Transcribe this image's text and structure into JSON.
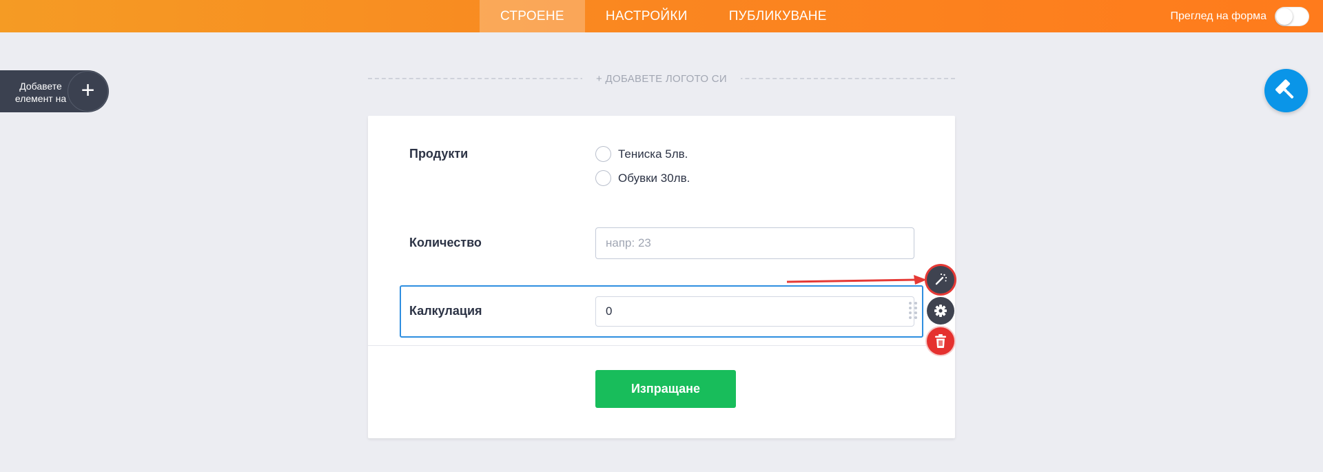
{
  "topbar": {
    "tabs": [
      {
        "label": "СТРОЕНЕ",
        "active": true
      },
      {
        "label": "НАСТРОЙКИ",
        "active": false
      },
      {
        "label": "ПУБЛИКУВАНЕ",
        "active": false
      }
    ],
    "preview_label": "Преглед на форма",
    "preview_toggle_on": false
  },
  "sidebar": {
    "add_element_label": "Добавете елемент на форма",
    "add_icon": "plus-icon"
  },
  "logo": {
    "placeholder": "+ ДОБАВЕТЕ ЛОГОТО СИ"
  },
  "form": {
    "fields": [
      {
        "label": "Продукти",
        "type": "radio",
        "options": [
          "Тениска 5лв.",
          "Обувки 30лв."
        ]
      },
      {
        "label": "Количество",
        "type": "number",
        "placeholder": "напр: 23",
        "value": ""
      },
      {
        "label": "Калкулация",
        "type": "calculation",
        "value": "0",
        "selected": true
      }
    ],
    "submit_label": "Изпращане"
  },
  "field_tools": [
    "magic-wand-icon",
    "gear-icon",
    "trash-icon"
  ],
  "colors": {
    "accent_orange": "#fa8620",
    "submit_green": "#18bd5b",
    "selection_blue": "#2e8ee0",
    "paint_button_blue": "#0a95e8",
    "delete_red": "#e5312f",
    "annotation_red": "#e53935"
  }
}
